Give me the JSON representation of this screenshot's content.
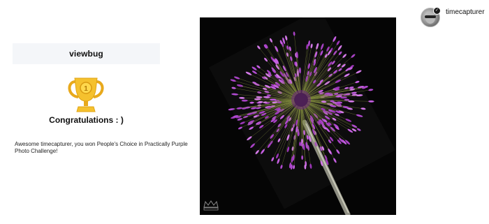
{
  "card": {
    "brand": "viewbug",
    "congrats": "Congratulations : )",
    "message": "Awesome timecapturer, you won People's Choice in Practically Purple Photo Challenge!",
    "trophy_icon": "trophy-icon",
    "trophy_number": "1"
  },
  "photo": {
    "subject": "allium-flower-photo",
    "watermark_icon": "crown-watermark-icon"
  },
  "user": {
    "username": "timecapturer",
    "avatar_icon": "avatar",
    "badge_icon": "verified-badge-icon",
    "badge_glyph": "✓"
  },
  "colors": {
    "card_bg": "#f4f6f9",
    "photo_bg": "#050505",
    "flower": "#b04ad0",
    "trophy_gold": "#f5c12e"
  }
}
